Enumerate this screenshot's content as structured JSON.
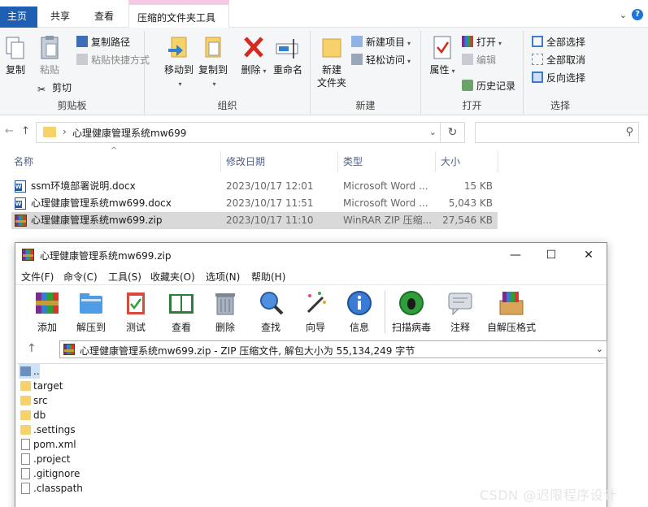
{
  "explorer": {
    "tabs": {
      "home": "主页",
      "share": "共享",
      "view": "查看",
      "tools": "压缩的文件夹工具"
    },
    "ribbon": {
      "clipboard": {
        "label": "剪贴板",
        "copy": "复制",
        "paste": "粘贴",
        "copy_path": "复制路径",
        "paste_shortcut": "粘贴快捷方式",
        "cut": "剪切"
      },
      "organize": {
        "label": "组织",
        "move_to": "移动到",
        "copy_to": "复制到",
        "delete": "删除",
        "rename": "重命名"
      },
      "new": {
        "label": "新建",
        "new_folder_line1": "新建",
        "new_folder_line2": "文件夹",
        "new_item": "新建项目",
        "easy_access": "轻松访问"
      },
      "open": {
        "label": "打开",
        "properties": "属性",
        "open": "打开",
        "edit": "编辑",
        "history": "历史记录"
      },
      "select": {
        "label": "选择",
        "select_all": "全部选择",
        "select_none": "全部取消",
        "invert": "反向选择"
      }
    },
    "address": {
      "path": "心理健康管理系统mw699",
      "separator": "›"
    },
    "columns": {
      "name": "名称",
      "date": "修改日期",
      "type": "类型",
      "size": "大小"
    },
    "files": [
      {
        "name": "ssm环境部署说明.docx",
        "date": "2023/10/17 12:01",
        "type": "Microsoft Word ...",
        "size": "15 KB"
      },
      {
        "name": "心理健康管理系统mw699.docx",
        "date": "2023/10/17 11:51",
        "type": "Microsoft Word ...",
        "size": "5,043 KB"
      },
      {
        "name": "心理健康管理系统mw699.zip",
        "date": "2023/10/17 11:10",
        "type": "WinRAR ZIP 压缩...",
        "size": "27,546 KB"
      }
    ]
  },
  "winrar": {
    "title": "心理健康管理系统mw699.zip",
    "menu": [
      "文件(F)",
      "命令(C)",
      "工具(S)",
      "收藏夹(O)",
      "选项(N)",
      "帮助(H)"
    ],
    "toolbar": [
      "添加",
      "解压到",
      "测试",
      "查看",
      "删除",
      "查找",
      "向导",
      "信息",
      "扫描病毒",
      "注释",
      "自解压格式"
    ],
    "path_text": "心理健康管理系统mw699.zip - ZIP 压缩文件, 解包大小为 55,134,249 字节",
    "items": [
      {
        "name": "..",
        "kind": "up"
      },
      {
        "name": "target",
        "kind": "folder"
      },
      {
        "name": "src",
        "kind": "folder"
      },
      {
        "name": "db",
        "kind": "folder"
      },
      {
        "name": ".settings",
        "kind": "folder"
      },
      {
        "name": "pom.xml",
        "kind": "file"
      },
      {
        "name": ".project",
        "kind": "file"
      },
      {
        "name": ".gitignore",
        "kind": "file"
      },
      {
        "name": ".classpath",
        "kind": "file"
      }
    ]
  },
  "watermark": "CSDN @迟限程序设计",
  "colors": {
    "home_tab": "#1e5fb4",
    "tools_tab_accent": "#f7c9e6",
    "selected_row": "#d9d9d9",
    "folder": "#f7d26a"
  }
}
